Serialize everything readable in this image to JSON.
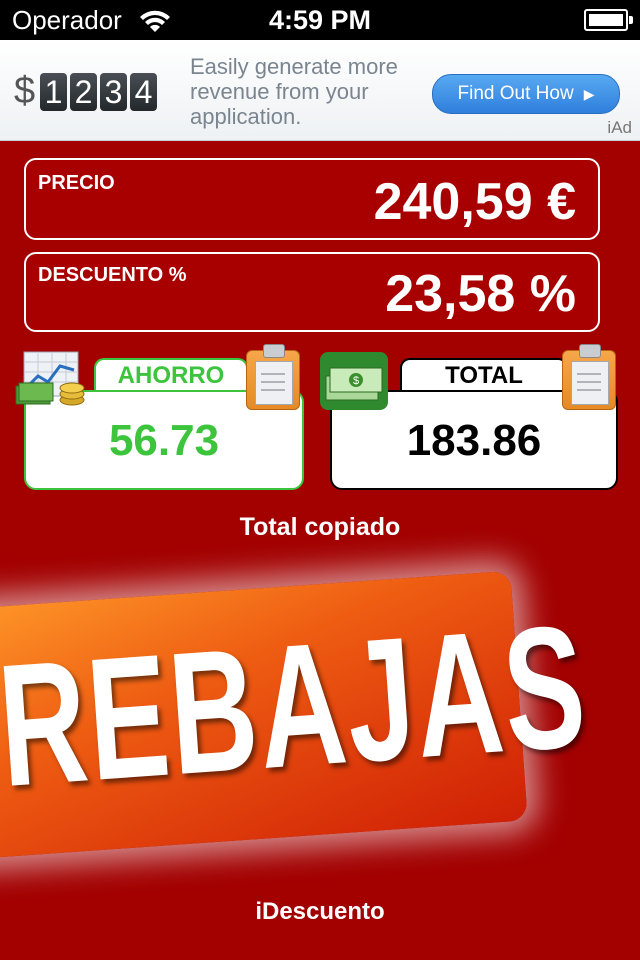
{
  "status_bar": {
    "carrier": "Operador",
    "time": "4:59 PM"
  },
  "ad": {
    "dollar": "$",
    "digits": [
      "1",
      "2",
      "3",
      "4"
    ],
    "text": "Easily generate more revenue from your application.",
    "button": "Find Out How",
    "badge": "iAd"
  },
  "price": {
    "label": "PRECIO",
    "value": "240,59 €"
  },
  "discount": {
    "label": "DESCUENTO %",
    "value": "23,58 %"
  },
  "savings": {
    "label": "AHORRO",
    "value": "56.73",
    "color": "#3cc43c"
  },
  "total": {
    "label": "TOTAL",
    "value": "183.86"
  },
  "status_message": "Total copiado",
  "banner": "REBAJAS",
  "app_name": "iDescuento",
  "icons": [
    "wifi-icon",
    "battery-icon",
    "savings-chart-coins-icon",
    "money-stack-icon",
    "clipboard-icon"
  ]
}
